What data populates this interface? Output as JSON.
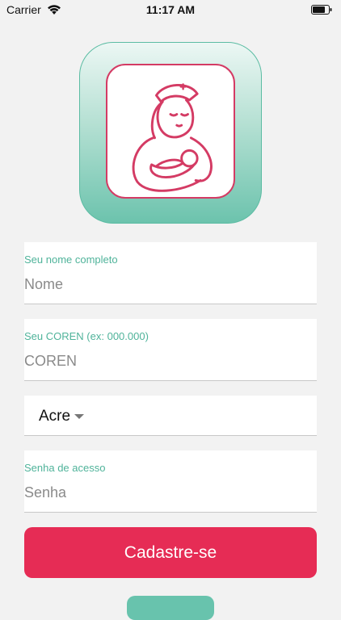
{
  "status_bar": {
    "carrier": "Carrier",
    "time": "11:17 AM"
  },
  "logo": {
    "icon": "nurse-with-baby-logo",
    "colors": {
      "frame": "#6cc3ad",
      "accent": "#d43b64"
    }
  },
  "form": {
    "name": {
      "label": "Seu nome completo",
      "placeholder": "Nome"
    },
    "coren": {
      "label": "Seu COREN (ex: 000.000)",
      "placeholder": "COREN"
    },
    "state": {
      "selected": "Acre"
    },
    "password": {
      "label": "Senha de acesso",
      "placeholder": "Senha"
    }
  },
  "actions": {
    "register_label": "Cadastre-se"
  },
  "colors": {
    "accent": "#e62c55",
    "label": "#4fb39a",
    "secondary": "#68c3ad"
  }
}
